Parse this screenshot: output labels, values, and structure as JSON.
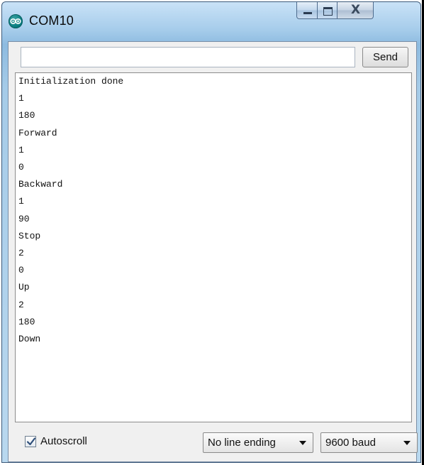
{
  "window": {
    "title": "COM10",
    "icon": "arduino-icon"
  },
  "caption_buttons": {
    "minimize_icon": "minimize-icon",
    "maximize_icon": "maximize-icon",
    "close_icon": "close-icon",
    "close_glyph": "X"
  },
  "input": {
    "value": "",
    "placeholder": ""
  },
  "send_button": {
    "label": "Send"
  },
  "output_lines": [
    "Initialization done",
    "1",
    "180",
    "Forward",
    "1",
    "0",
    "Backward",
    "1",
    "90",
    "Stop",
    "2",
    "0",
    "Up",
    "2",
    "180",
    "Down"
  ],
  "autoscroll": {
    "label": "Autoscroll",
    "checked": true
  },
  "line_ending": {
    "selected": "No line ending"
  },
  "baud_rate": {
    "selected": "9600 baud"
  },
  "colors": {
    "titlebar": "#a7cdeb",
    "client_bg": "#f0f0f0",
    "icon_teal": "#00777a"
  }
}
